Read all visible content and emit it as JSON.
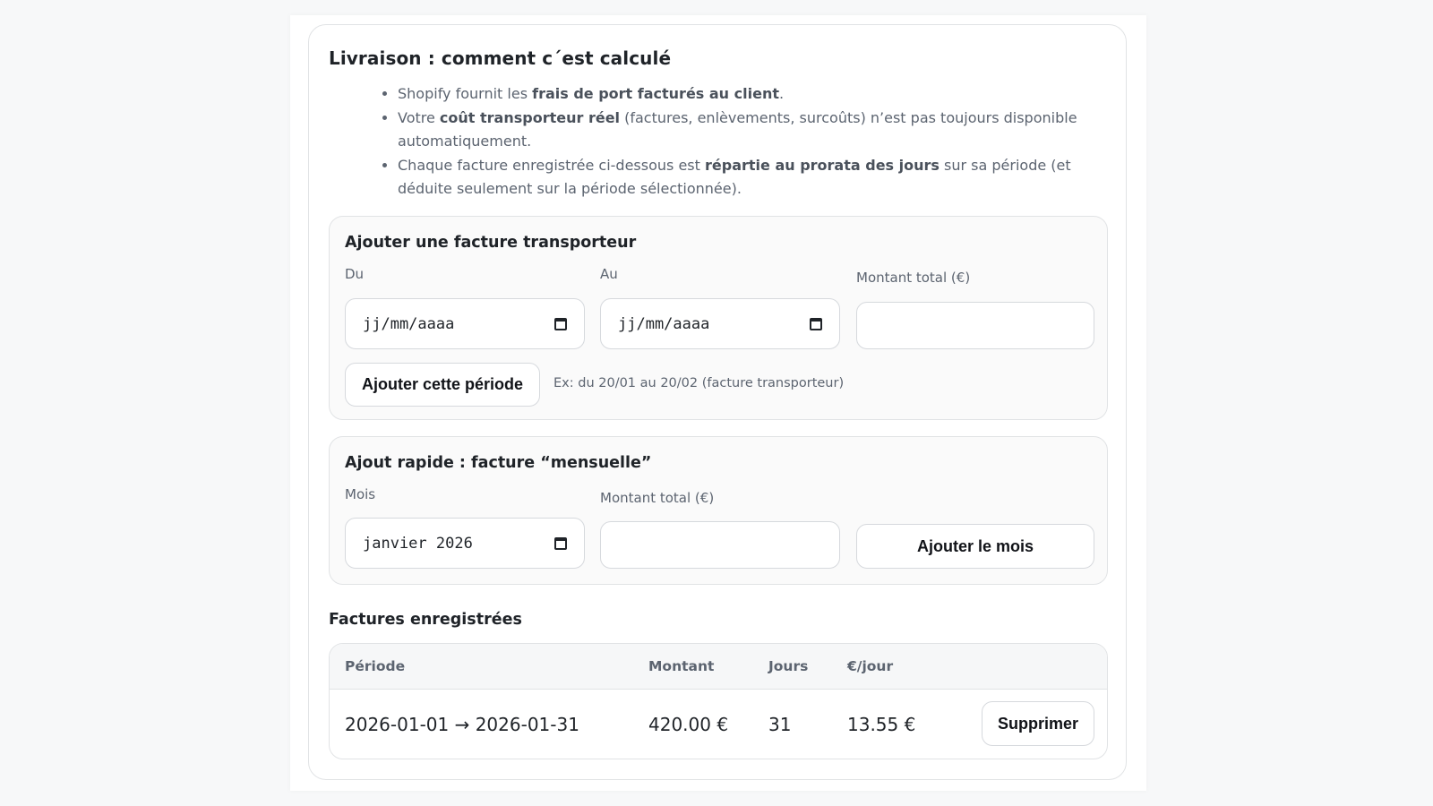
{
  "delivery": {
    "title": "Livraison : comment c´est calculé",
    "bullets": {
      "b1": {
        "t1": "Shopify fournit les ",
        "s1": "frais de port facturés au client",
        "t2": "."
      },
      "b2": {
        "t1": "Votre ",
        "s1": "coût transporteur réel",
        "t2": " (factures, enlèvements, surcoûts) n’est pas toujours disponible automatiquement."
      },
      "b3": {
        "t1": "Chaque facture enregistrée ci-dessous est ",
        "s1": "répartie au prorata des jours",
        "t2": " sur sa période (et déduite seulement sur la période sélectionnée)."
      }
    }
  },
  "add_invoice": {
    "title": "Ajouter une facture transporteur",
    "from_label": "Du",
    "from_value": "jj/mm/aaaa",
    "to_label": "Au",
    "to_value": "jj/mm/aaaa",
    "amount_label": "Montant total (€)",
    "amount_value": "",
    "button": "Ajouter cette période",
    "hint": "Ex: du 20/01 au 20/02 (facture transporteur)"
  },
  "quick_add": {
    "title": "Ajout rapide : facture “mensuelle”",
    "month_label": "Mois",
    "month_value": "janvier 2026",
    "amount_label": "Montant total (€)",
    "amount_value": "",
    "button": "Ajouter le mois"
  },
  "invoices": {
    "title": "Factures enregistrées",
    "columns": [
      "Période",
      "Montant",
      "Jours",
      "€/jour"
    ],
    "rows": [
      {
        "period": "2026-01-01 → 2026-01-31",
        "amount": "420.00 €",
        "days": "31",
        "per_day": "13.55 €",
        "action": "Supprimer"
      }
    ]
  }
}
